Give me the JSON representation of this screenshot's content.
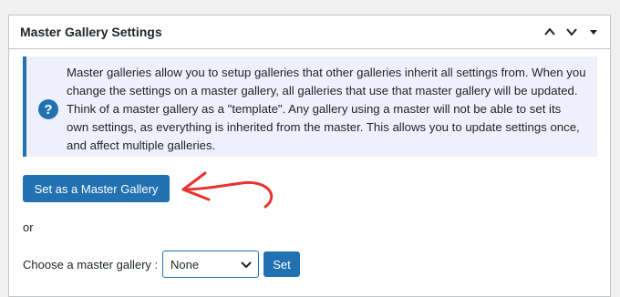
{
  "panel": {
    "title": "Master Gallery Settings"
  },
  "header_controls": {
    "icons": [
      "chevron-up-icon",
      "chevron-down-icon",
      "triangle-down-icon"
    ]
  },
  "notice": {
    "icon": "question-mark-circle-icon",
    "icon_glyph": "?",
    "text": "Master galleries allow you to setup galleries that other galleries inherit all settings from. When you change the settings on a master gallery, all galleries that use that master gallery will be updated. Think of a master gallery as a \"template\". Any gallery using a master will not be able to set its own settings, as everything is inherited from the master. This allows you to update settings once, and affect multiple galleries."
  },
  "actions": {
    "set_master_label": "Set as a Master Gallery",
    "or_label": "or",
    "choose_label": "Choose a master gallery :",
    "select_value": "None",
    "set_label": "Set"
  },
  "colors": {
    "accent": "#2271b1",
    "notice_bg": "#f0f0fc",
    "annotation_arrow": "#e8322e"
  }
}
